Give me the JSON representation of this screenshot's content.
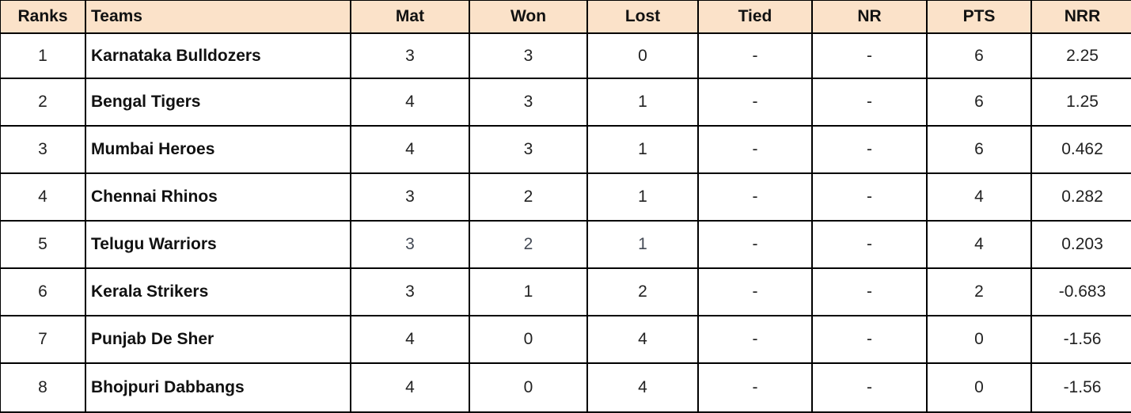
{
  "table": {
    "headers": [
      "Ranks",
      "Teams",
      "Mat",
      "Won",
      "Lost",
      "Tied",
      "NR",
      "PTS",
      "NRR"
    ],
    "rows": [
      {
        "rank": "1",
        "team": "Karnataka Bulldozers",
        "mat": "3",
        "won": "3",
        "lost": "0",
        "tied": "-",
        "nr": "-",
        "pts": "6",
        "nrr": "2.25"
      },
      {
        "rank": "2",
        "team": "Bengal Tigers",
        "mat": "4",
        "won": "3",
        "lost": "1",
        "tied": "-",
        "nr": "-",
        "pts": "6",
        "nrr": "1.25"
      },
      {
        "rank": "3",
        "team": "Mumbai Heroes",
        "mat": "4",
        "won": "3",
        "lost": "1",
        "tied": "-",
        "nr": "-",
        "pts": "6",
        "nrr": "0.462"
      },
      {
        "rank": "4",
        "team": "Chennai Rhinos",
        "mat": "3",
        "won": "2",
        "lost": "1",
        "tied": "-",
        "nr": "-",
        "pts": "4",
        "nrr": "0.282"
      },
      {
        "rank": "5",
        "team": "Telugu Warriors",
        "mat": "3",
        "won": "2",
        "lost": "1",
        "tied": "-",
        "nr": "-",
        "pts": "4",
        "nrr": "0.203"
      },
      {
        "rank": "6",
        "team": "Kerala Strikers",
        "mat": "3",
        "won": "1",
        "lost": "2",
        "tied": "-",
        "nr": "-",
        "pts": "2",
        "nrr": "-0.683"
      },
      {
        "rank": "7",
        "team": "Punjab De Sher",
        "mat": "4",
        "won": "0",
        "lost": "4",
        "tied": "-",
        "nr": "-",
        "pts": "0",
        "nrr": "-1.56"
      },
      {
        "rank": "8",
        "team": "Bhojpuri Dabbangs",
        "mat": "4",
        "won": "0",
        "lost": "4",
        "tied": "-",
        "nr": "-",
        "pts": "0",
        "nrr": "-1.56"
      }
    ]
  },
  "colors": {
    "header_background": "#fbe2c9",
    "border": "#000000"
  }
}
